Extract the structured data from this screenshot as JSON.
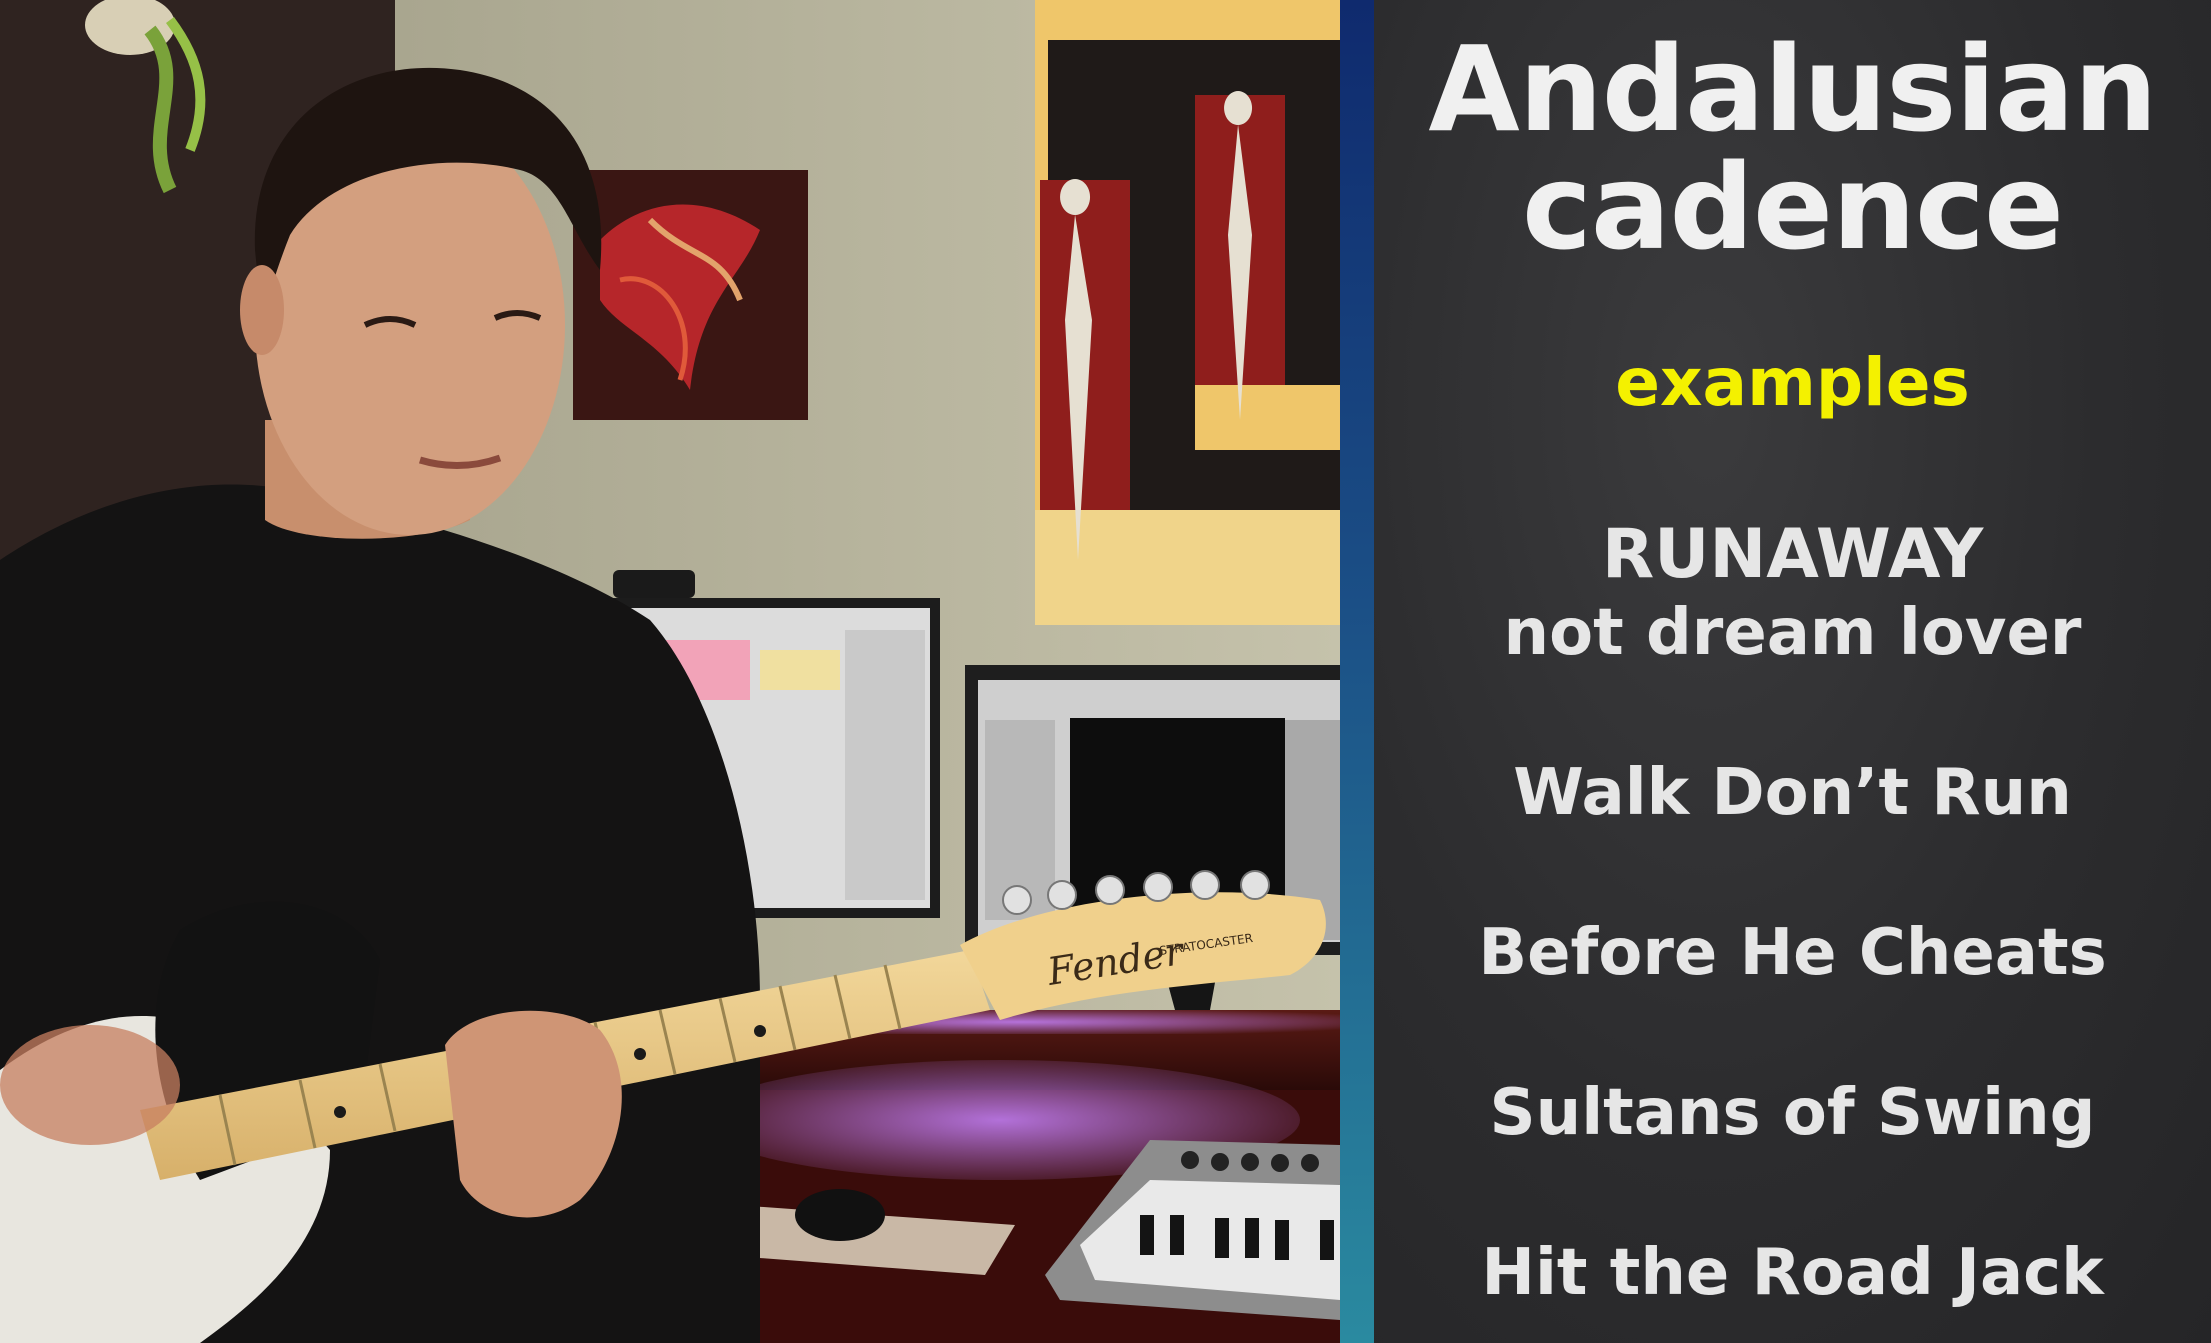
{
  "panel": {
    "title_line1": "Andalusian",
    "title_line2": "cadence",
    "subtitle": "examples",
    "examples": [
      {
        "line1": "RUNAWAY",
        "line2": "not dream lover"
      },
      {
        "line1": "Walk Don’t Run"
      },
      {
        "line1": "Before He Cheats"
      },
      {
        "line1": "Sultans of Swing"
      },
      {
        "line1": "Hit the Road Jack"
      }
    ]
  },
  "scene": {
    "headstock_brand": "Fender",
    "headstock_model": "STRATOCASTER"
  },
  "colors": {
    "panel_bg": "#2c2c2e",
    "title_text": "#f0f0f0",
    "subtitle_text": "#f4f100",
    "divider": "#1b4f86"
  }
}
